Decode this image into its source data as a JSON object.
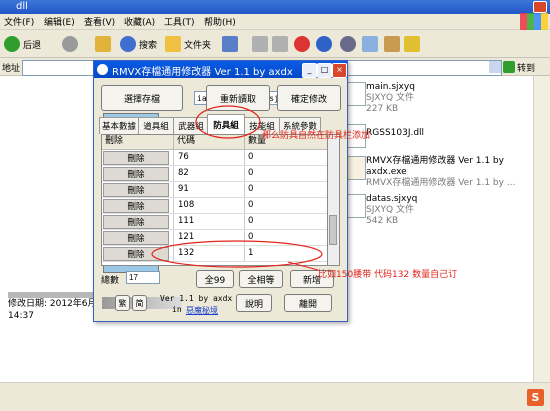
{
  "explorer": {
    "title": "dll",
    "menu": [
      "文件(F)",
      "编辑(E)",
      "查看(V)",
      "收藏(A)",
      "工具(T)",
      "帮助(H)"
    ],
    "toolbar": {
      "back": "后退",
      "search": "搜索",
      "folders": "文件夹"
    },
    "address_label": "地址",
    "go_label": "转到",
    "files": [
      {
        "name": "main.sjxyq",
        "type": "SJXYQ 文件",
        "size": "227 KB"
      },
      {
        "name": "RGSS103J.dll",
        "type": "",
        "size": ""
      },
      {
        "name": "RMVX存檔通用修改器 Ver 1.1 by axdx.exe",
        "type": "RMVX存檔通用修改器 Ver 1.1 by ...",
        "size": ""
      },
      {
        "name": "datas.sjxyq",
        "type": "SJXYQ 文件",
        "size": "542 KB"
      }
    ],
    "details": {
      "modified": "修改日期: 2012年6月17日, 14:37"
    }
  },
  "dialog": {
    "title": "RMVX存檔通用修改器 Ver 1.1 by axdx",
    "select_save": "選擇存檔",
    "path": "ian3\\dll\\datas.sjxyq",
    "reload": "重新讀取",
    "confirm": "確定修改",
    "tabs": [
      "基本數據",
      "道具組",
      "武器組",
      "防具組",
      "技能組",
      "系統參數"
    ],
    "active_tab": "防具組",
    "columns": [
      "刪除",
      "代碼",
      "數量"
    ],
    "rows": [
      {
        "del": "刪除",
        "code": "76",
        "qty": "0"
      },
      {
        "del": "刪除",
        "code": "82",
        "qty": "0"
      },
      {
        "del": "刪除",
        "code": "91",
        "qty": "0"
      },
      {
        "del": "刪除",
        "code": "108",
        "qty": "0"
      },
      {
        "del": "刪除",
        "code": "111",
        "qty": "0"
      },
      {
        "del": "刪除",
        "code": "121",
        "qty": "0"
      },
      {
        "del": "刪除",
        "code": "132",
        "qty": "1"
      }
    ],
    "count_label": "總數",
    "count_value": "17",
    "btn_all99": "全99",
    "btn_all_same": "全相等",
    "btn_add": "新增",
    "btn_trad": "繁",
    "btn_simp": "简",
    "credit_line1": "Ver 1.1 by axdx",
    "credit_prefix": "in",
    "credit_link": "惡魔秘境",
    "btn_help": "說明",
    "btn_exit": "離開"
  },
  "annotations": {
    "top": "那么防具自然在防具栏添加",
    "bottom": "比如150腰带 代码132 数量自己订"
  }
}
